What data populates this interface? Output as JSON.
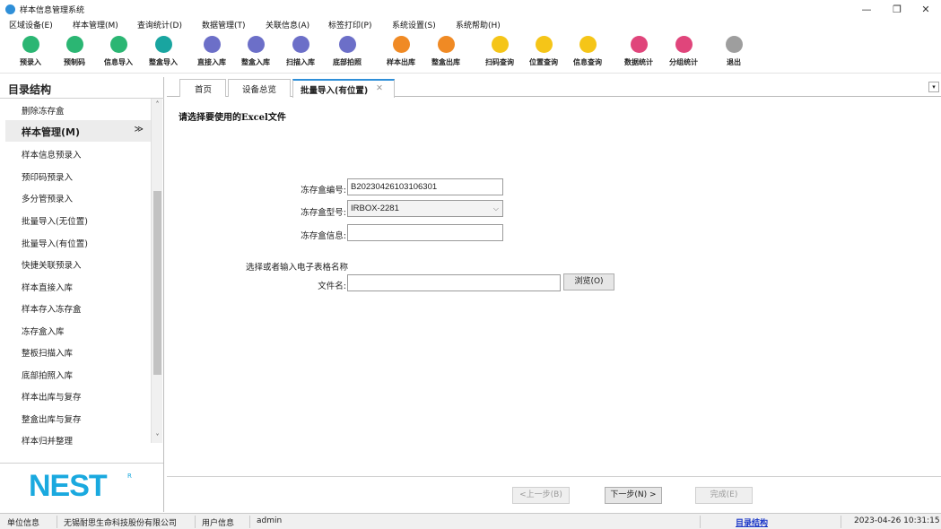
{
  "window": {
    "title": "样本信息管理系统",
    "minimize": "—",
    "maximize": "❐",
    "close": "✕"
  },
  "menu": [
    "区域设备(E)",
    "样本管理(M)",
    "查询统计(D)",
    "数据管理(T)",
    "关联信息(A)",
    "标签打印(P)",
    "系统设置(S)",
    "系统帮助(H)"
  ],
  "toolbar": [
    {
      "label": "预录入",
      "icon": "edit-icon",
      "color": "#2bb673"
    },
    {
      "label": "预制码",
      "icon": "barcode-icon",
      "color": "#2bb673"
    },
    {
      "label": "信息导入",
      "icon": "import-icon",
      "color": "#2bb673"
    },
    {
      "label": "整盒导入",
      "icon": "box-import-icon",
      "color": "#19a5a0"
    },
    {
      "label": "直接入库",
      "icon": "store-icon",
      "color": "#6c6fc8"
    },
    {
      "label": "整盒入库",
      "icon": "box-store-icon",
      "color": "#6c6fc8"
    },
    {
      "label": "扫描入库",
      "icon": "scan-icon",
      "color": "#6c6fc8"
    },
    {
      "label": "底部拍照",
      "icon": "camera-icon",
      "color": "#6c6fc8"
    },
    {
      "label": "样本出库",
      "icon": "out-icon",
      "color": "#f08a24"
    },
    {
      "label": "整盒出库",
      "icon": "box-out-icon",
      "color": "#f08a24"
    },
    {
      "label": "扫码查询",
      "icon": "search-icon",
      "color": "#f5c518"
    },
    {
      "label": "位置查询",
      "icon": "location-icon",
      "color": "#f5c518"
    },
    {
      "label": "信息查询",
      "icon": "info-icon",
      "color": "#f5c518"
    },
    {
      "label": "数据统计",
      "icon": "chart-icon",
      "color": "#e0457b"
    },
    {
      "label": "分组统计",
      "icon": "group-icon",
      "color": "#e0457b"
    },
    {
      "label": "退出",
      "icon": "power-icon",
      "color": "#9e9e9e"
    }
  ],
  "sidebar": {
    "title": "目录结构",
    "top_item": "删除冻存盒",
    "group": "样本管理(M)",
    "group_chevron": "≫",
    "items": [
      "样本信息预录入",
      "预印码预录入",
      "多分管预录入",
      "批量导入(无位置)",
      "批量导入(有位置)",
      "快捷关联预录入",
      "样本直接入库",
      "样本存入冻存盒",
      "冻存盒入库",
      "整板扫描入库",
      "底部拍照入库",
      "样本出库与复存",
      "整盒出库与复存",
      "样本归并整理"
    ],
    "scroll_up": "˄",
    "scroll_down": "˅",
    "logo": "NEST",
    "logo_mark": "R"
  },
  "tabs": {
    "items": [
      "首页",
      "设备总览",
      "批量导入(有位置)"
    ],
    "close": "✕",
    "dropdown": "▾"
  },
  "form": {
    "instruction": "请选择要使用的Excel文件",
    "box_id_label": "冻存盒编号:",
    "box_id_value": "B20230426103106301",
    "box_type_label": "冻存盒型号:",
    "box_type_value": "IRBOX-2281",
    "box_info_label": "冻存盒信息:",
    "box_info_value": "",
    "sheet_prompt": "选择或者输入电子表格名称",
    "file_label": "文件名:",
    "file_value": "",
    "browse": "浏览(O)",
    "select_chevron": "⌵"
  },
  "wizard": {
    "prev": "<上一步(B)",
    "next": "下一步(N) >",
    "finish": "完成(E)"
  },
  "status": {
    "unit_label": "单位信息",
    "unit_value": "无锡耐思生命科技股份有限公司",
    "user_label": "用户信息",
    "user_value": "admin",
    "link": "目录结构",
    "datetime": "2023-04-26 10:31:15"
  }
}
